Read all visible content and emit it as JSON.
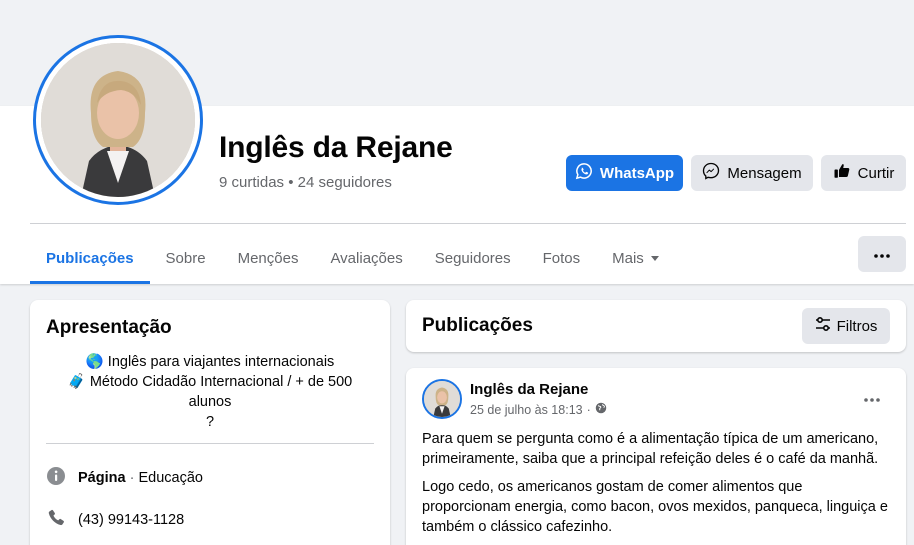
{
  "page": {
    "name": "Inglês da Rejane",
    "stats": "9 curtidas • 24 seguidores"
  },
  "actions": {
    "whatsapp": "WhatsApp",
    "message": "Mensagem",
    "like": "Curtir"
  },
  "tabs": [
    {
      "label": "Publicações",
      "active": true
    },
    {
      "label": "Sobre"
    },
    {
      "label": "Menções"
    },
    {
      "label": "Avaliações"
    },
    {
      "label": "Seguidores"
    },
    {
      "label": "Fotos"
    },
    {
      "label": "Mais"
    }
  ],
  "intro": {
    "title": "Apresentação",
    "bio_line1": "🌎 Inglês para viajantes internacionais",
    "bio_line2": "🧳 Método Cidadão Internacional / + de 500",
    "bio_line3": "alunos",
    "bio_line4": "?",
    "type_label": "Página",
    "type_sep": "·",
    "category": "Educação",
    "phone": "(43) 99143-1128"
  },
  "publications": {
    "title": "Publicações",
    "filter": "Filtros"
  },
  "post": {
    "author": "Inglês da Rejane",
    "date": "25 de julho às 18:13",
    "date_sep": "·",
    "paragraph1": "Para quem se pergunta como é a alimentação típica de um americano, primeiramente, saiba que a principal refeição deles é o café da manhã.",
    "paragraph2": "Logo cedo, os americanos gostam de comer alimentos que proporcionam energia, como bacon, ovos mexidos, panqueca, linguiça e também o clássico cafezinho."
  },
  "colors": {
    "accent": "#1b74e4",
    "background": "#f0f2f5",
    "secondary_text": "#65676b",
    "button_gray": "#e4e6eb"
  },
  "icons": {
    "whatsapp": "whatsapp-icon",
    "messenger": "messenger-icon",
    "like": "thumbs-up-icon",
    "more": "ellipsis-icon",
    "dropdown": "caret-down-icon",
    "filter": "filter-sliders-icon",
    "info": "info-icon",
    "phone": "phone-icon",
    "globe": "globe-icon"
  }
}
